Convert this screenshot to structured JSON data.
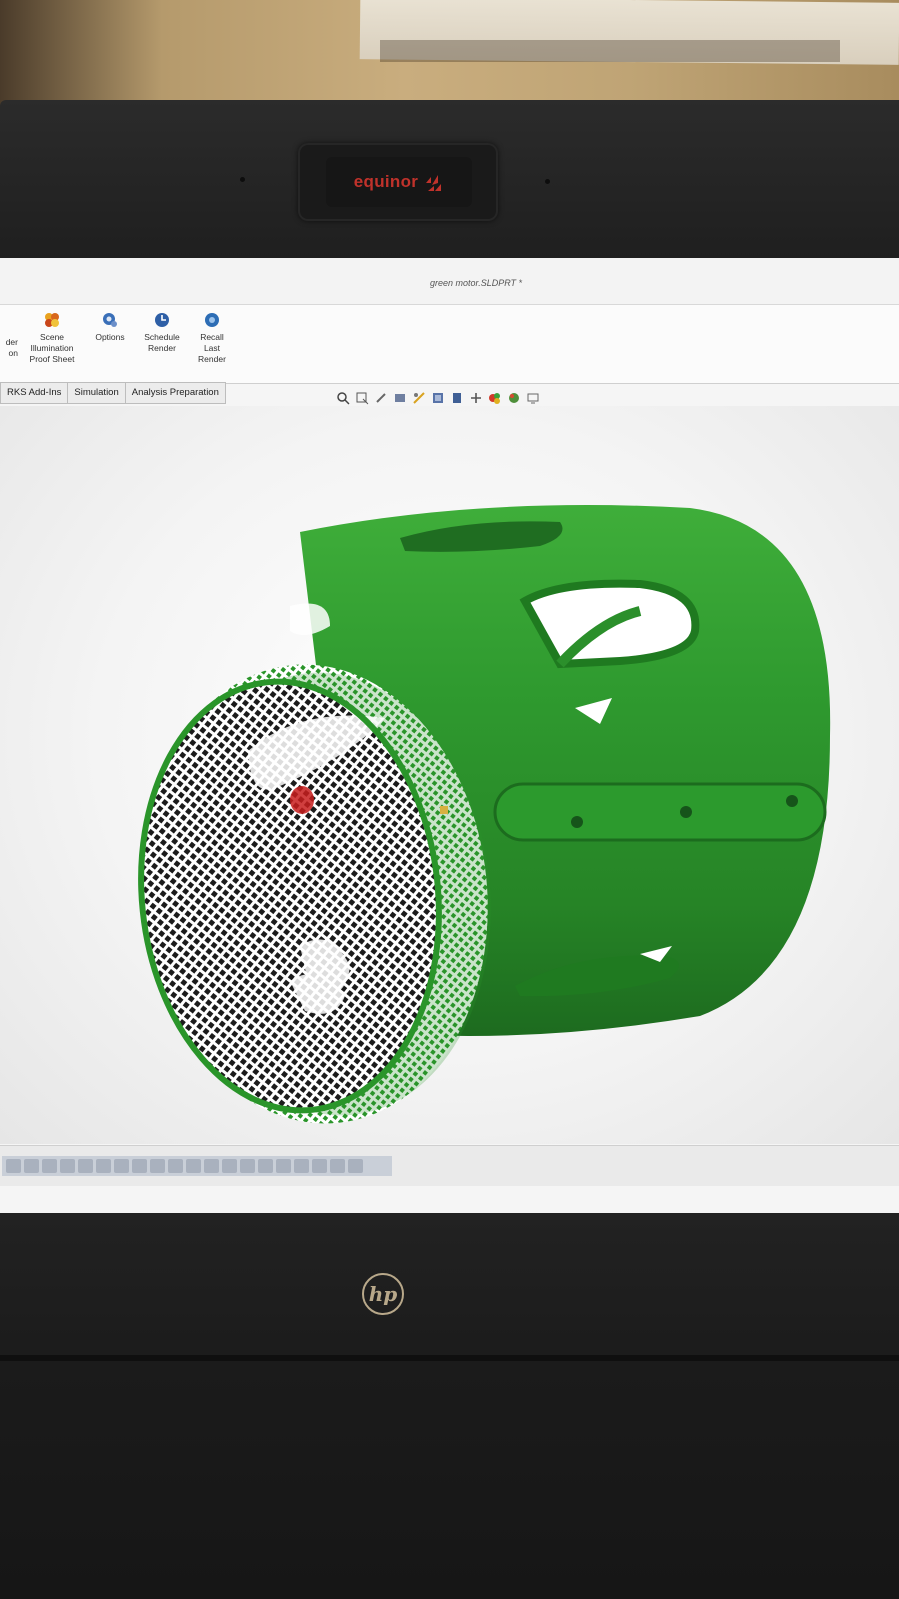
{
  "webcam_logo": {
    "text": "equinor"
  },
  "window": {
    "title": "green motor.SLDPRT *"
  },
  "ribbon": {
    "buttons": [
      {
        "lines": [
          "der",
          "on"
        ]
      },
      {
        "lines": [
          "Scene",
          "Illumination",
          "Proof Sheet"
        ]
      },
      {
        "lines": [
          "Options"
        ]
      },
      {
        "lines": [
          "Schedule",
          "Render"
        ]
      },
      {
        "lines": [
          "Recall",
          "Last",
          "Render"
        ]
      }
    ]
  },
  "tabs": [
    "RKS Add-Ins",
    "Simulation",
    "Analysis Preparation"
  ],
  "laptop_brand": "hp",
  "colors": {
    "model_green": "#2f9a2f",
    "logo_red": "#c0322b"
  }
}
